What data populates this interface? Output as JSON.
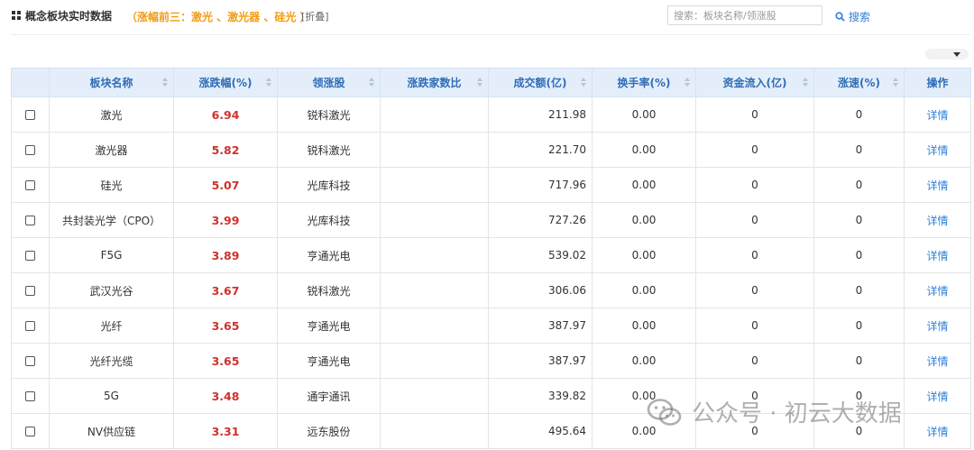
{
  "header": {
    "title": "概念板块实时数据",
    "top3": "（涨幅前三：激光 、激光器 、硅光 ）",
    "fold": "[折叠]",
    "search_placeholder": "搜索：板块名称/领涨股",
    "search_label": "搜索"
  },
  "table": {
    "columns": [
      "板块名称",
      "涨跌幅(%)",
      "领涨股",
      "涨跌家数比",
      "成交额(亿)",
      "换手率(%)",
      "资金流入(亿)",
      "涨速(%)",
      "操作"
    ],
    "rows": [
      {
        "name": "激光",
        "change": "6.94",
        "leader": "锐科激光",
        "ratio": "",
        "amount": "211.98",
        "turnover": "0.00",
        "inflow": "0",
        "speed": "0",
        "action": "详情"
      },
      {
        "name": "激光器",
        "change": "5.82",
        "leader": "锐科激光",
        "ratio": "",
        "amount": "221.70",
        "turnover": "0.00",
        "inflow": "0",
        "speed": "0",
        "action": "详情"
      },
      {
        "name": "硅光",
        "change": "5.07",
        "leader": "光库科技",
        "ratio": "",
        "amount": "717.96",
        "turnover": "0.00",
        "inflow": "0",
        "speed": "0",
        "action": "详情"
      },
      {
        "name": "共封装光学（CPO）",
        "change": "3.99",
        "leader": "光库科技",
        "ratio": "",
        "amount": "727.26",
        "turnover": "0.00",
        "inflow": "0",
        "speed": "0",
        "action": "详情"
      },
      {
        "name": "F5G",
        "change": "3.89",
        "leader": "亨通光电",
        "ratio": "",
        "amount": "539.02",
        "turnover": "0.00",
        "inflow": "0",
        "speed": "0",
        "action": "详情"
      },
      {
        "name": "武汉光谷",
        "change": "3.67",
        "leader": "锐科激光",
        "ratio": "",
        "amount": "306.06",
        "turnover": "0.00",
        "inflow": "0",
        "speed": "0",
        "action": "详情"
      },
      {
        "name": "光纤",
        "change": "3.65",
        "leader": "亨通光电",
        "ratio": "",
        "amount": "387.97",
        "turnover": "0.00",
        "inflow": "0",
        "speed": "0",
        "action": "详情"
      },
      {
        "name": "光纤光缆",
        "change": "3.65",
        "leader": "亨通光电",
        "ratio": "",
        "amount": "387.97",
        "turnover": "0.00",
        "inflow": "0",
        "speed": "0",
        "action": "详情"
      },
      {
        "name": "5G",
        "change": "3.48",
        "leader": "通宇通讯",
        "ratio": "",
        "amount": "339.82",
        "turnover": "0.00",
        "inflow": "0",
        "speed": "0",
        "action": "详情"
      },
      {
        "name": "NV供应链",
        "change": "3.31",
        "leader": "远东股份",
        "ratio": "",
        "amount": "495.64",
        "turnover": "0.00",
        "inflow": "0",
        "speed": "0",
        "action": "详情"
      }
    ]
  },
  "watermark": "公众号 · 初云大数据",
  "colors": {
    "accent": "#2f7fd9",
    "header_bg": "#e4eefb",
    "rise": "#d0312d",
    "highlight": "#f39c12"
  },
  "icons": [
    "grid-icon",
    "search-icon",
    "wechat-icon",
    "sort-icon",
    "caret-down-icon"
  ]
}
